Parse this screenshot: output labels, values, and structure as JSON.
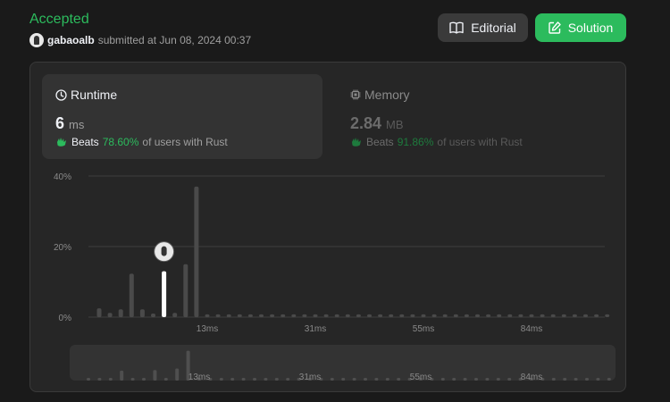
{
  "header": {
    "status": "Accepted",
    "username": "gabaoalb",
    "submitted_text": "submitted at Jun 08, 2024 00:37"
  },
  "buttons": {
    "editorial_label": "Editorial",
    "solution_label": "Solution"
  },
  "runtime": {
    "title": "Runtime",
    "value": "6",
    "unit": "ms",
    "beats_word": "Beats",
    "beats_pct": "78.60%",
    "beats_suffix": "of users with Rust"
  },
  "memory": {
    "title": "Memory",
    "value": "2.84",
    "unit": "MB",
    "beats_word": "Beats",
    "beats_pct": "91.86%",
    "beats_suffix": "of users with Rust"
  },
  "colors": {
    "accent_green": "#2cbb5d",
    "bar_gray": "#4a4a4a",
    "highlight_bar": "#ffffff"
  },
  "chart_data": {
    "type": "bar",
    "title": "",
    "xlabel": "",
    "ylabel": "",
    "ylim": [
      0,
      40
    ],
    "ytick_labels": [
      "40%",
      "20%",
      "0%"
    ],
    "yticks": [
      40,
      20,
      0
    ],
    "xtick_labels": [
      "13ms",
      "31ms",
      "55ms",
      "84ms"
    ],
    "xtick_bar_index": [
      10,
      20,
      30,
      40
    ],
    "highlight_index": 6,
    "highlight_label": "6 ms",
    "values": [
      2.5,
      1.2,
      2.2,
      12.3,
      2.2,
      1.0,
      13.0,
      1.2,
      15.0,
      37.0,
      0.8,
      0.8,
      0.8,
      0.8,
      0.8,
      0.8,
      0.8,
      0.8,
      0.8,
      0.8,
      0.8,
      0.8,
      0.8,
      0.8,
      0.8,
      0.8,
      0.8,
      0.8,
      0.8,
      0.8,
      0.8,
      0.8,
      0.8,
      0.8,
      0.8,
      0.8,
      0.8,
      0.8,
      0.8,
      0.8,
      0.8,
      0.8,
      0.8,
      0.8,
      0.8,
      0.8,
      0.8,
      0.8
    ]
  },
  "minimap": {
    "xtick_labels": [
      "13ms",
      "31ms",
      "55ms",
      "84ms"
    ]
  }
}
